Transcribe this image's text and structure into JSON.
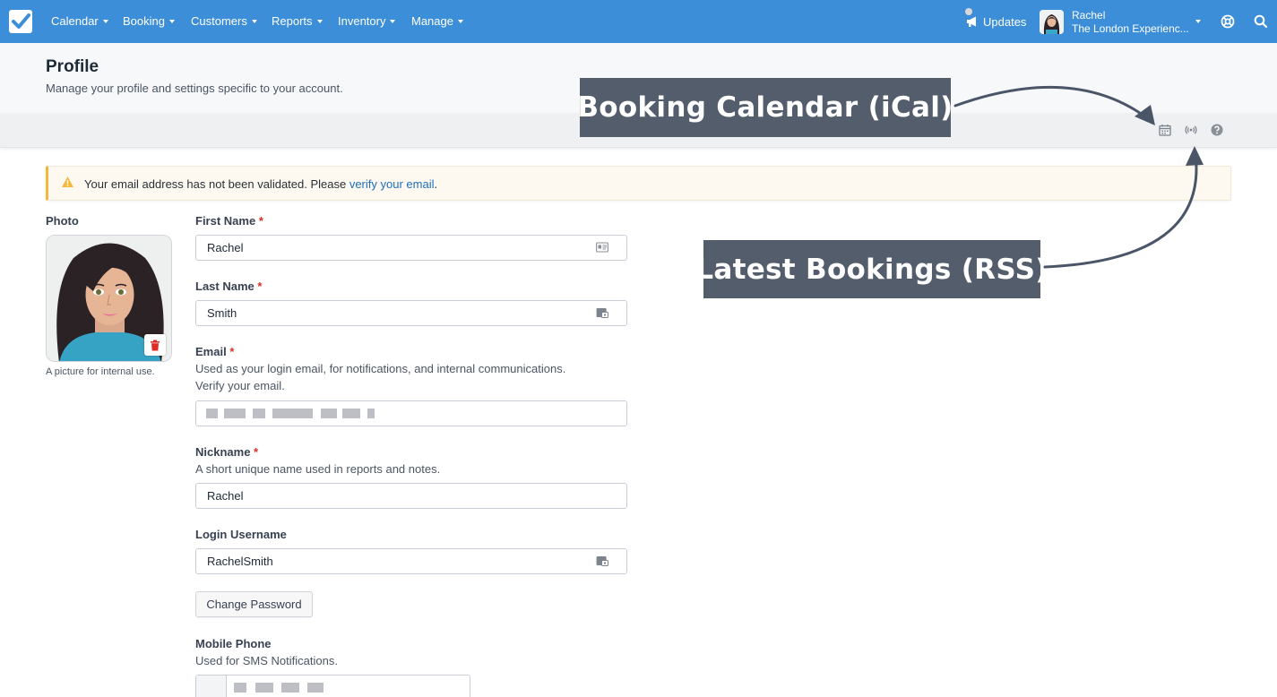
{
  "nav": {
    "items": [
      "Calendar",
      "Booking",
      "Customers",
      "Reports",
      "Inventory",
      "Manage"
    ],
    "updates_label": "Updates",
    "user_name": "Rachel",
    "user_org": "The London Experienc..."
  },
  "header": {
    "title": "Profile",
    "subtitle": "Manage your profile and settings specific to your account."
  },
  "alert": {
    "text": "Your email address has not been validated. Please ",
    "link": "verify your email",
    "suffix": "."
  },
  "photo": {
    "label": "Photo",
    "caption": "A picture for internal use."
  },
  "form": {
    "first_name": {
      "label": "First Name",
      "required": "*",
      "value": "Rachel"
    },
    "last_name": {
      "label": "Last Name",
      "required": "*",
      "value": "Smith"
    },
    "email": {
      "label": "Email",
      "required": "*",
      "help": "Used as your login email, for notifications, and internal communications.",
      "verify_link": "Verify your email."
    },
    "nickname": {
      "label": "Nickname",
      "required": "*",
      "help": "A short unique name used in reports and notes.",
      "value": "Rachel"
    },
    "username": {
      "label": "Login Username",
      "value": "RachelSmith"
    },
    "change_password": "Change Password",
    "mobile": {
      "label": "Mobile Phone",
      "help": "Used for SMS Notifications."
    }
  },
  "callouts": {
    "ical": "Booking Calendar (iCal)",
    "rss": "Latest Bookings (RSS)"
  },
  "colors": {
    "nav_bg": "#3b8ed7",
    "link": "#1d6fbf",
    "required": "#d93025",
    "alert_accent": "#f5b83d",
    "callout_bg": "#545d6b",
    "arrow": "#4a5567"
  }
}
